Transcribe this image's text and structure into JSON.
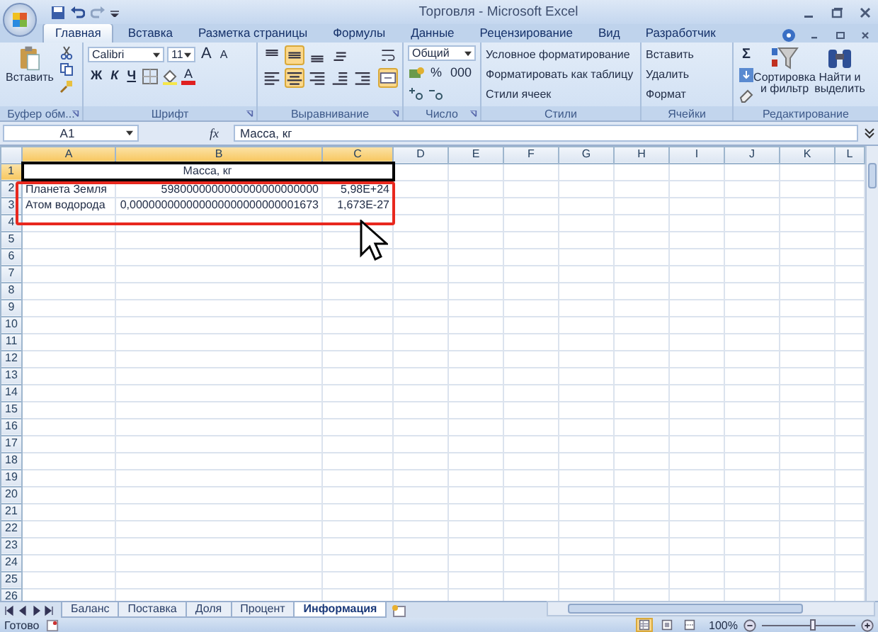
{
  "window": {
    "title": "Торговля - Microsoft Excel"
  },
  "ribbon_tabs": [
    {
      "label": "Главная",
      "selected": true
    },
    {
      "label": "Вставка",
      "selected": false
    },
    {
      "label": "Разметка страницы",
      "selected": false
    },
    {
      "label": "Формулы",
      "selected": false
    },
    {
      "label": "Данные",
      "selected": false
    },
    {
      "label": "Рецензирование",
      "selected": false
    },
    {
      "label": "Вид",
      "selected": false
    },
    {
      "label": "Разработчик",
      "selected": false
    }
  ],
  "ribbon": {
    "clipboard": {
      "paste": "Вставить",
      "label": "Буфер обм..."
    },
    "font": {
      "font_name": "Calibri",
      "font_size": "11",
      "grow": "A",
      "shrink": "A",
      "bold": "Ж",
      "italic": "К",
      "underline": "Ч",
      "font_color_letter": "A",
      "label": "Шрифт"
    },
    "alignment": {
      "top_buttons": [
        {
          "kind": "top",
          "on": false
        },
        {
          "kind": "middle",
          "on": true
        },
        {
          "kind": "bottom",
          "on": false
        },
        {
          "kind": "orientation",
          "on": false
        }
      ],
      "bottom_buttons": [
        {
          "kind": "left",
          "on": false
        },
        {
          "kind": "center",
          "on": true
        },
        {
          "kind": "right",
          "on": false
        },
        {
          "kind": "outdent",
          "on": false
        },
        {
          "kind": "indent",
          "on": false
        }
      ],
      "wrap": {
        "on": false
      },
      "merge": {
        "on": true
      },
      "label": "Выравнивание"
    },
    "number": {
      "format": "Общий",
      "percent": "%",
      "thousands": "000",
      "label": "Число"
    },
    "styles": {
      "items": [
        "Условное форматирование",
        "Форматировать как таблицу",
        "Стили ячеек"
      ],
      "label": "Стили"
    },
    "cells": {
      "items": [
        "Вставить",
        "Удалить",
        "Формат"
      ],
      "label": "Ячейки"
    },
    "editing": {
      "sum": "Σ",
      "sort": "Сортировка и фильтр",
      "find": "Найти и выделить",
      "label": "Редактирование"
    }
  },
  "formula_bar": {
    "name_box": "A1",
    "function_label": "fx",
    "value": "Масса, кг"
  },
  "columns": [
    {
      "letter": "A",
      "selected": true
    },
    {
      "letter": "B",
      "selected": true
    },
    {
      "letter": "C",
      "selected": true
    },
    {
      "letter": "D",
      "selected": false
    },
    {
      "letter": "E",
      "selected": false
    },
    {
      "letter": "F",
      "selected": false
    },
    {
      "letter": "G",
      "selected": false
    },
    {
      "letter": "H",
      "selected": false
    },
    {
      "letter": "I",
      "selected": false
    },
    {
      "letter": "J",
      "selected": false
    },
    {
      "letter": "K",
      "selected": false
    },
    {
      "letter": "L",
      "selected": false
    }
  ],
  "rows": [
    {
      "number": "1",
      "selected": true,
      "kind": "title",
      "title": "Масса, кг"
    },
    {
      "number": "2",
      "selected": false,
      "kind": "data",
      "name": "Планета Земля",
      "decimal": "5980000000000000000000000",
      "scientific": "5,98E+24"
    },
    {
      "number": "3",
      "selected": false,
      "kind": "data",
      "name": "Атом водорода",
      "decimal": "0,000000000000000000000000001673",
      "scientific": "1,673E-27"
    },
    {
      "number": "4",
      "selected": false,
      "kind": "empty"
    },
    {
      "number": "5",
      "selected": false,
      "kind": "empty"
    },
    {
      "number": "6",
      "selected": false,
      "kind": "empty"
    },
    {
      "number": "7",
      "selected": false,
      "kind": "empty"
    },
    {
      "number": "8",
      "selected": false,
      "kind": "empty"
    },
    {
      "number": "9",
      "selected": false,
      "kind": "empty"
    },
    {
      "number": "10",
      "selected": false,
      "kind": "empty"
    },
    {
      "number": "11",
      "selected": false,
      "kind": "empty"
    },
    {
      "number": "12",
      "selected": false,
      "kind": "empty"
    },
    {
      "number": "13",
      "selected": false,
      "kind": "empty"
    },
    {
      "number": "14",
      "selected": false,
      "kind": "empty"
    },
    {
      "number": "15",
      "selected": false,
      "kind": "empty"
    },
    {
      "number": "16",
      "selected": false,
      "kind": "empty"
    },
    {
      "number": "17",
      "selected": false,
      "kind": "empty"
    },
    {
      "number": "18",
      "selected": false,
      "kind": "empty"
    },
    {
      "number": "19",
      "selected": false,
      "kind": "empty"
    },
    {
      "number": "20",
      "selected": false,
      "kind": "empty"
    },
    {
      "number": "21",
      "selected": false,
      "kind": "empty"
    },
    {
      "number": "22",
      "selected": false,
      "kind": "empty"
    },
    {
      "number": "23",
      "selected": false,
      "kind": "empty"
    },
    {
      "number": "24",
      "selected": false,
      "kind": "empty"
    },
    {
      "number": "25",
      "selected": false,
      "kind": "empty"
    },
    {
      "number": "26",
      "selected": false,
      "kind": "empty"
    }
  ],
  "sheet_tabs": [
    {
      "label": "Баланс",
      "selected": false
    },
    {
      "label": "Поставка",
      "selected": false
    },
    {
      "label": "Доля",
      "selected": false
    },
    {
      "label": "Процент",
      "selected": false
    },
    {
      "label": "Информация",
      "selected": true
    }
  ],
  "status_bar": {
    "status": "Готово",
    "views": [
      {
        "kind": "normal",
        "selected": true
      },
      {
        "kind": "layout",
        "selected": false
      },
      {
        "kind": "break",
        "selected": false
      }
    ],
    "zoom": "100%",
    "zoom_level": {
      "level": 0.55
    }
  }
}
